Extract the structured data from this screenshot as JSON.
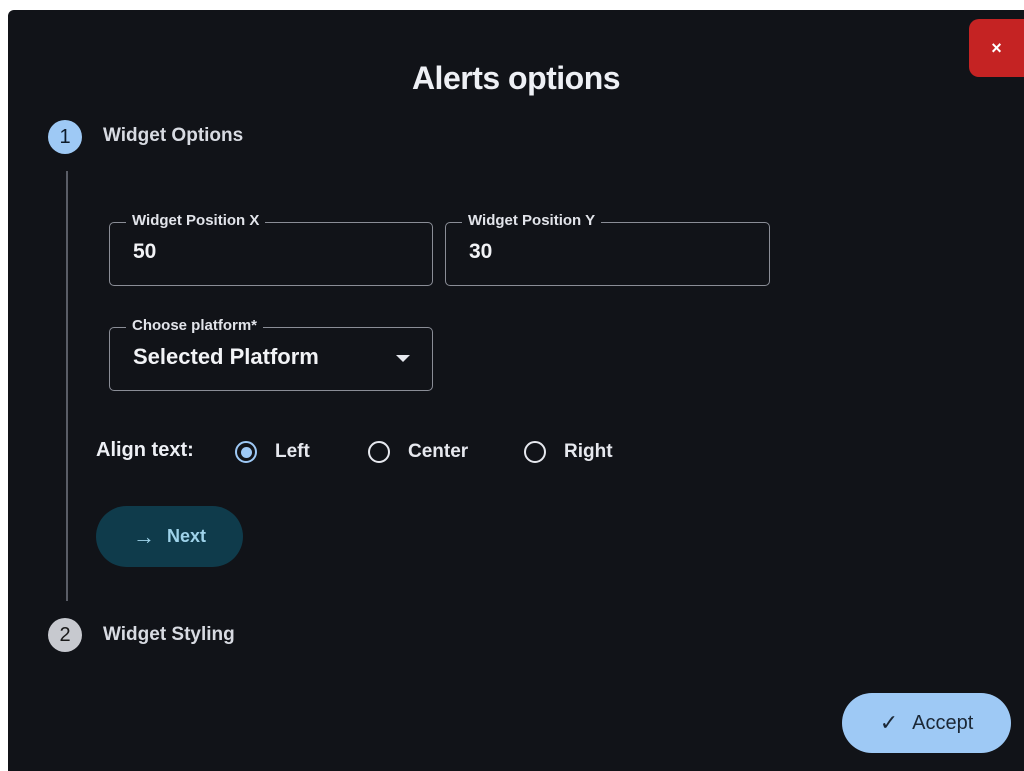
{
  "dialog": {
    "title": "Alerts options",
    "close_label": "×"
  },
  "stepper": {
    "steps": [
      {
        "number": "1",
        "label": "Widget Options",
        "state": "active"
      },
      {
        "number": "2",
        "label": "Widget Styling",
        "state": "inactive"
      }
    ]
  },
  "fields": {
    "position_x": {
      "label": "Widget Position X",
      "value": "50"
    },
    "position_y": {
      "label": "Widget Position Y",
      "value": "30"
    },
    "platform": {
      "label": "Choose platform*",
      "value": "Selected Platform"
    }
  },
  "align": {
    "label": "Align text:",
    "options": [
      "Left",
      "Center",
      "Right"
    ],
    "selected": "Left"
  },
  "buttons": {
    "next_label": "Next",
    "accept_label": "Accept"
  },
  "icons": {
    "close": "close-icon",
    "next": "arrow-right-icon",
    "accept": "check-icon",
    "dropdown": "caret-down-icon"
  },
  "colors": {
    "background": "#111318",
    "accent": "#9ec9f5",
    "close": "#c52323",
    "next_button": "#0f3b4b"
  }
}
